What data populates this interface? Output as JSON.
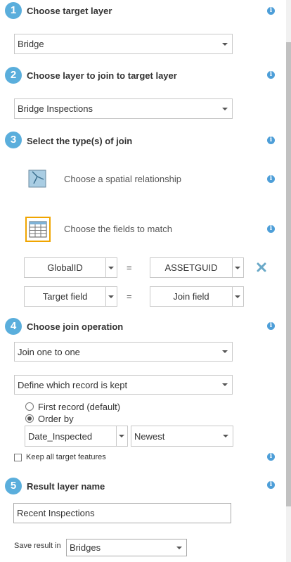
{
  "steps": {
    "step1": {
      "num": "1",
      "title": "Choose target layer",
      "dropdown": "Bridge"
    },
    "step2": {
      "num": "2",
      "title": "Choose layer to join to target layer",
      "dropdown": "Bridge Inspections"
    },
    "step3": {
      "num": "3",
      "title": "Select the type(s) of join",
      "spatial_label": "Choose a spatial relationship",
      "fields_label": "Choose the fields to match",
      "rows": [
        {
          "target": "GlobalID",
          "eq": "=",
          "join": "ASSETGUID"
        },
        {
          "target": "Target field",
          "eq": "=",
          "join": "Join field"
        }
      ]
    },
    "step4": {
      "num": "4",
      "title": "Choose join operation",
      "operation": "Join one to one",
      "record_kept": "Define which record is kept",
      "radio_first": "First record (default)",
      "radio_order": "Order by",
      "order_field": "Date_Inspected",
      "order_dir": "Newest",
      "keep_all": "Keep all target features"
    },
    "step5": {
      "num": "5",
      "title": "Result layer name",
      "name_value": "Recent Inspections",
      "save_label": "Save result in",
      "save_folder": "Bridges"
    }
  },
  "info_glyph": "i",
  "colors": {
    "step_badge": "#5aaedc",
    "info": "#4d9ed8",
    "selected_border": "#f0a500",
    "remove": "#6aa9c8"
  }
}
